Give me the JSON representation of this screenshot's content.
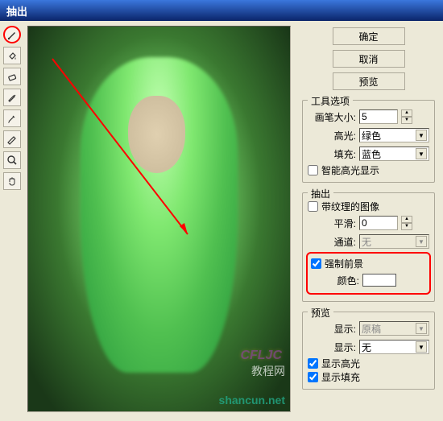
{
  "title": "抽出",
  "buttons": {
    "ok": "确定",
    "cancel": "取消",
    "preview": "预览"
  },
  "toolOptions": {
    "title": "工具选项",
    "brushLabel": "画笔大小:",
    "brushValue": "5",
    "highlightLabel": "高光:",
    "highlightValue": "绿色",
    "fillLabel": "填充:",
    "fillValue": "蓝色",
    "smartLabel": "智能高光显示"
  },
  "extract": {
    "title": "抽出",
    "texturedLabel": "带纹理的图像",
    "smoothLabel": "平滑:",
    "smoothValue": "0",
    "channelLabel": "通道:",
    "channelValue": "无",
    "forceLabel": "强制前景",
    "colorLabel": "颜色:"
  },
  "preview": {
    "title": "预览",
    "showLabel": "显示:",
    "showValue": "原稿",
    "displayLabel": "显示:",
    "displayValue": "无",
    "showHighlight": "显示高光",
    "showFill": "显示填充"
  },
  "watermark1": "CFLJC",
  "watermark2": "shancun.net",
  "watermark3": "教程网"
}
